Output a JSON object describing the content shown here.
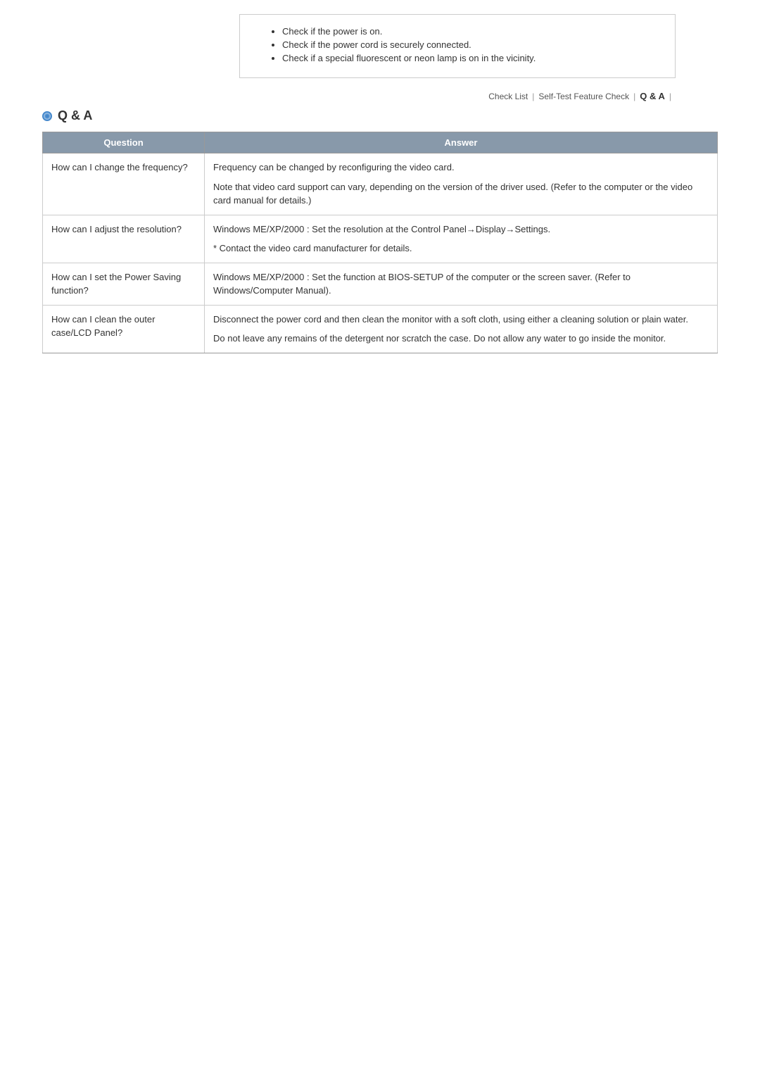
{
  "top_checklist": {
    "items": [
      "Check if the power is on.",
      "Check if the power cord is securely connected.",
      "Check if a special fluorescent or neon lamp is on in the vicinity."
    ]
  },
  "nav": {
    "check_list": "Check List",
    "separator1": "|",
    "self_test": "Self-Test Feature Check",
    "separator2": "|",
    "active": "Q & A",
    "separator3": "|"
  },
  "section": {
    "title": "Q & A"
  },
  "table": {
    "header_question": "Question",
    "header_answer": "Answer",
    "rows": [
      {
        "question": "How can I change the frequency?",
        "answer_parts": [
          "Frequency can be changed by reconfiguring the video card.",
          "Note that video card support can vary, depending on the version of the driver used. (Refer to the computer or the video card manual for details.)"
        ]
      },
      {
        "question": "How can I adjust the resolution?",
        "answer_parts": [
          "Windows ME/XP/2000 : Set the resolution at the Control Panel→Display→Settings.",
          "* Contact the video card manufacturer for details."
        ]
      },
      {
        "question": "How can I set the Power Saving function?",
        "answer_parts": [
          "Windows ME/XP/2000 : Set the function at BIOS-SETUP of the computer or the screen saver. (Refer to Windows/Computer Manual)."
        ]
      },
      {
        "question": "How can I clean the outer case/LCD Panel?",
        "answer_parts": [
          "Disconnect the power cord and then clean the monitor with a soft cloth, using either a cleaning solution or plain water.",
          "Do not leave any remains of the detergent nor scratch the case. Do not allow any water to go inside the monitor."
        ]
      }
    ]
  }
}
